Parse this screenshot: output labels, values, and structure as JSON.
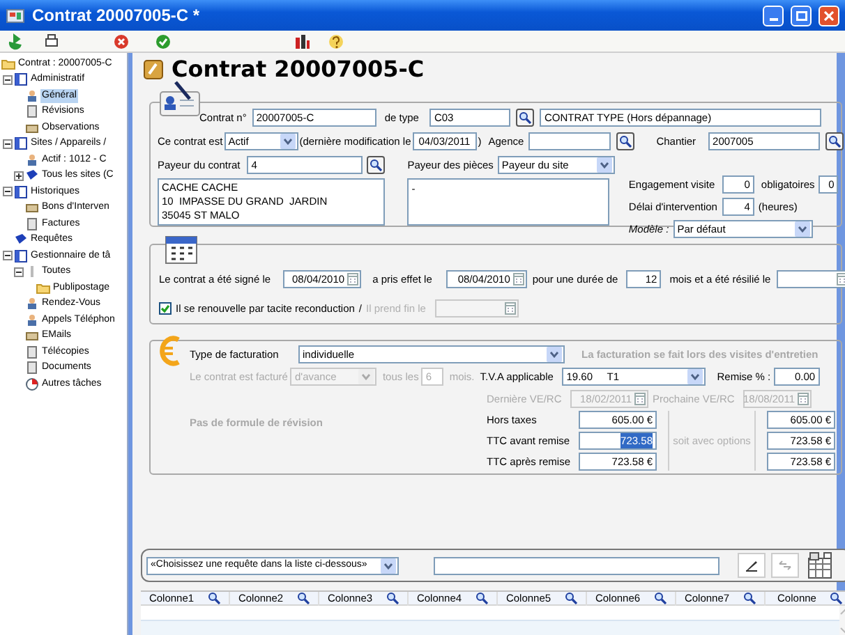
{
  "window": {
    "title": "Contrat 20007005-C *"
  },
  "sidebar": {
    "tree": [
      {
        "label": "Contrat : 20007005-C",
        "kind": "folder",
        "selected": false,
        "children": [
          {
            "label": "Administratif",
            "kind": "book",
            "selected": false,
            "expanded": true,
            "children": [
              {
                "label": "Général",
                "kind": "person",
                "selected": true
              },
              {
                "label": "Révisions",
                "kind": "document",
                "selected": false
              },
              {
                "label": "Observations",
                "kind": "note",
                "selected": false
              }
            ]
          },
          {
            "label": "Sites / Appareils /",
            "kind": "book",
            "selected": false,
            "expanded": true,
            "children": [
              {
                "label": "Actif : 1012 - C",
                "kind": "person",
                "selected": false
              },
              {
                "label": "Tous les sites (C",
                "kind": "bluebook",
                "selected": false,
                "expanded": false
              }
            ]
          },
          {
            "label": "Historiques",
            "kind": "book",
            "selected": false,
            "expanded": true,
            "children": [
              {
                "label": "Bons d'Interven",
                "kind": "note",
                "selected": false
              },
              {
                "label": "Factures",
                "kind": "document",
                "selected": false
              }
            ]
          },
          {
            "label": "Requêtes",
            "kind": "bluebook",
            "selected": false
          },
          {
            "label": "Gestionnaire de tâ",
            "kind": "book",
            "selected": false,
            "expanded": true,
            "children": [
              {
                "label": "Toutes",
                "kind": "pin",
                "selected": false,
                "expanded": true,
                "children": [
                  {
                    "label": "Publipostage",
                    "kind": "folder",
                    "selected": false
                  }
                ]
              },
              {
                "label": "Rendez-Vous",
                "kind": "person",
                "selected": false
              },
              {
                "label": "Appels Téléphon",
                "kind": "person",
                "selected": false
              },
              {
                "label": "EMails",
                "kind": "note",
                "selected": false
              },
              {
                "label": "Télécopies",
                "kind": "document",
                "selected": false
              },
              {
                "label": "Documents",
                "kind": "document",
                "selected": false
              },
              {
                "label": "Autres tâches",
                "kind": "clock",
                "selected": false
              }
            ]
          }
        ]
      }
    ]
  },
  "heading": "Contrat 20007005-C",
  "contract": {
    "number_label": "Contrat n°",
    "number": "20007005-C",
    "type_label": "de type",
    "type_code": "C03",
    "type_name": "CONTRAT TYPE (Hors dépannage)",
    "status_label": "Ce contrat est",
    "status": "Actif",
    "modified_label": "(dernière modification le",
    "modified_date": "04/03/2011",
    "modified_close": ")",
    "agency_label": "Agence",
    "site_label": "Chantier",
    "site": "2007005",
    "payer_label": "Payeur du contrat",
    "payer": "4",
    "address_lines": [
      "CACHE CACHE",
      "10  IMPASSE DU GRAND  JARDIN",
      "35045 ST MALO"
    ],
    "parts_payer_label": "Payeur des pièces",
    "parts_payer": "Payeur du site",
    "parts_address": "-",
    "visit_label": "Engagement visite",
    "visit": "0",
    "mandatory_label": "obligatoires",
    "mandatory": "0",
    "delay_label": "Délai d'intervention",
    "delay": "4",
    "delay_unit": "(heures)",
    "model_label": "Modèle :",
    "model": "Par défaut"
  },
  "dates": {
    "signed_label": "Le contrat a été signé le",
    "signed": "08/04/2010",
    "effect_label": "a pris effet le",
    "effect": "08/04/2010",
    "duration_label": "pour une durée de",
    "duration": "12",
    "terminated_label": "mois et a été résilié le",
    "renewal": {
      "label": "Il se renouvelle par tacite reconduction",
      "checked": true
    },
    "slash": "/",
    "end_label": "Il prend fin le"
  },
  "billing": {
    "type_label": "Type de facturation",
    "type": "individuelle",
    "note": "La facturation se fait lors des visites d'entretien",
    "billed_label": "Le contrat est facturé",
    "billed": "d'avance",
    "every_label": "tous les",
    "every": "6",
    "months": "mois.",
    "vat_label": "T.V.A applicable",
    "vat": "19.60     T1",
    "discount_label": "Remise % :",
    "discount": "0.00",
    "last_label": "Dernière VE/RC",
    "last": "18/02/2011",
    "next_label": "Prochaine VE/RC",
    "next": "18/08/2011",
    "revision": "Pas de formule de révision",
    "options_label": "soit avec options",
    "totals": [
      {
        "label": "Hors taxes",
        "value": "605.00 €",
        "selected": false,
        "options": "605.00 €"
      },
      {
        "label": "TTC avant remise",
        "value": "723.58",
        "selected": true,
        "options": "723.58 €"
      },
      {
        "label": "TTC après remise",
        "value": "723.58 €",
        "selected": false,
        "options": "723.58 €"
      }
    ]
  },
  "query": {
    "request": "«Choisissez une requête dans la liste ci-dessous»",
    "columns": [
      "Colonne1",
      "Colonne2",
      "Colonne3",
      "Colonne4",
      "Colonne5",
      "Colonne6",
      "Colonne7",
      "Colonne"
    ]
  }
}
